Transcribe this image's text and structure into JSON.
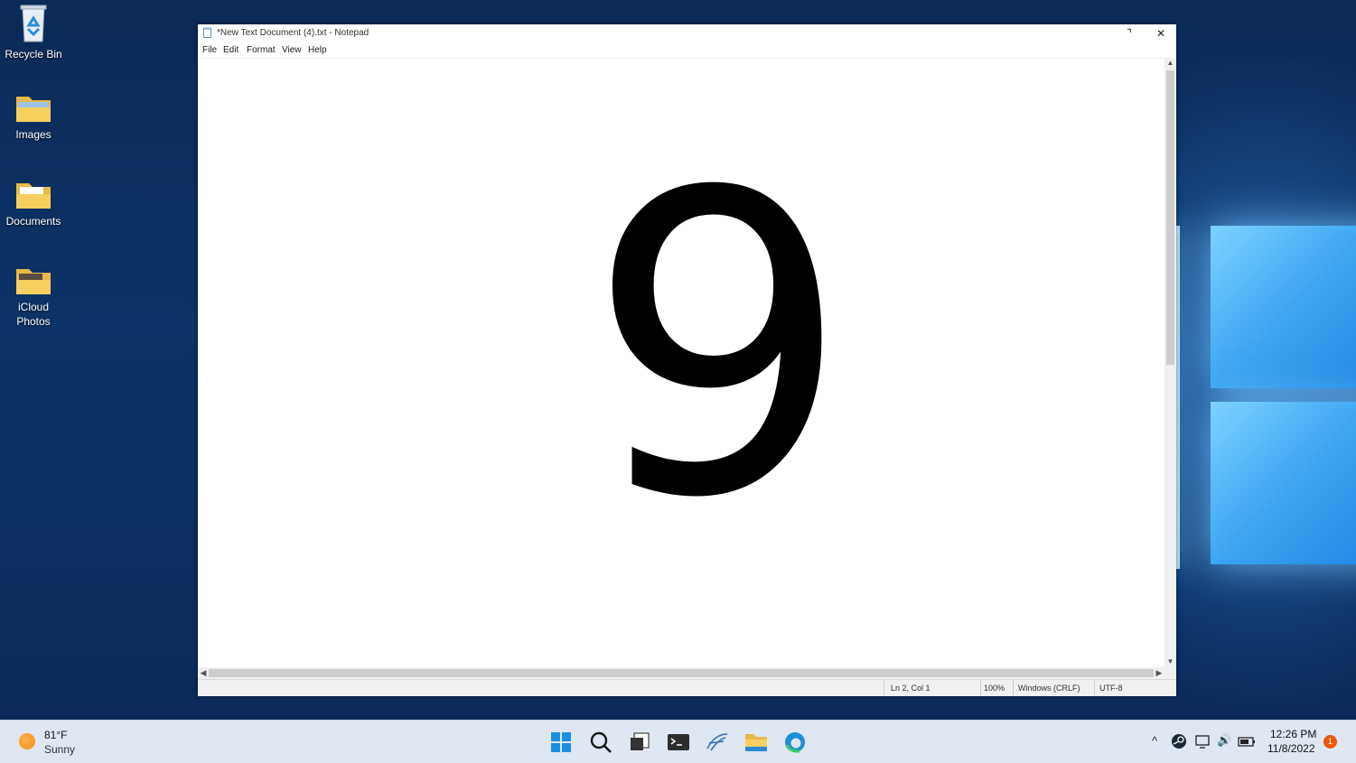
{
  "desktop": {
    "icons": [
      {
        "label": "Recycle Bin",
        "icon": "recycle-bin-icon"
      },
      {
        "label": "Images",
        "icon": "folder-icon"
      },
      {
        "label": "Documents",
        "icon": "folder-icon"
      },
      {
        "label": "iCloud Photos",
        "icon": "folder-icon"
      }
    ]
  },
  "notepad": {
    "title": "*New Text Document (4).txt - Notepad",
    "maximize_glyph": "⌝",
    "close_glyph": "✕",
    "menu": [
      "File",
      "Edit",
      "Format",
      "View",
      "Help"
    ],
    "content": "9",
    "status": {
      "position": "Ln 2, Col 1",
      "zoom": "100%",
      "line_ending": "Windows (CRLF)",
      "encoding": "UTF-8"
    }
  },
  "taskbar": {
    "weather": {
      "temp": "81°F",
      "condition": "Sunny"
    },
    "pinned": [
      "windows-start-icon",
      "search-icon",
      "task-view-icon",
      "terminal-icon",
      "custom-app-icon",
      "file-explorer-icon",
      "edge-icon"
    ],
    "tray": {
      "chevron": "^",
      "volume": "🔊"
    },
    "clock": {
      "time": "12:26 PM",
      "date": "11/8/2022"
    },
    "notification_count": "1"
  },
  "colors": {
    "wallpaper": "#0c3468",
    "taskbar": "#dfe7f2",
    "accent": "#0078d4",
    "notification": "#e8590c"
  }
}
